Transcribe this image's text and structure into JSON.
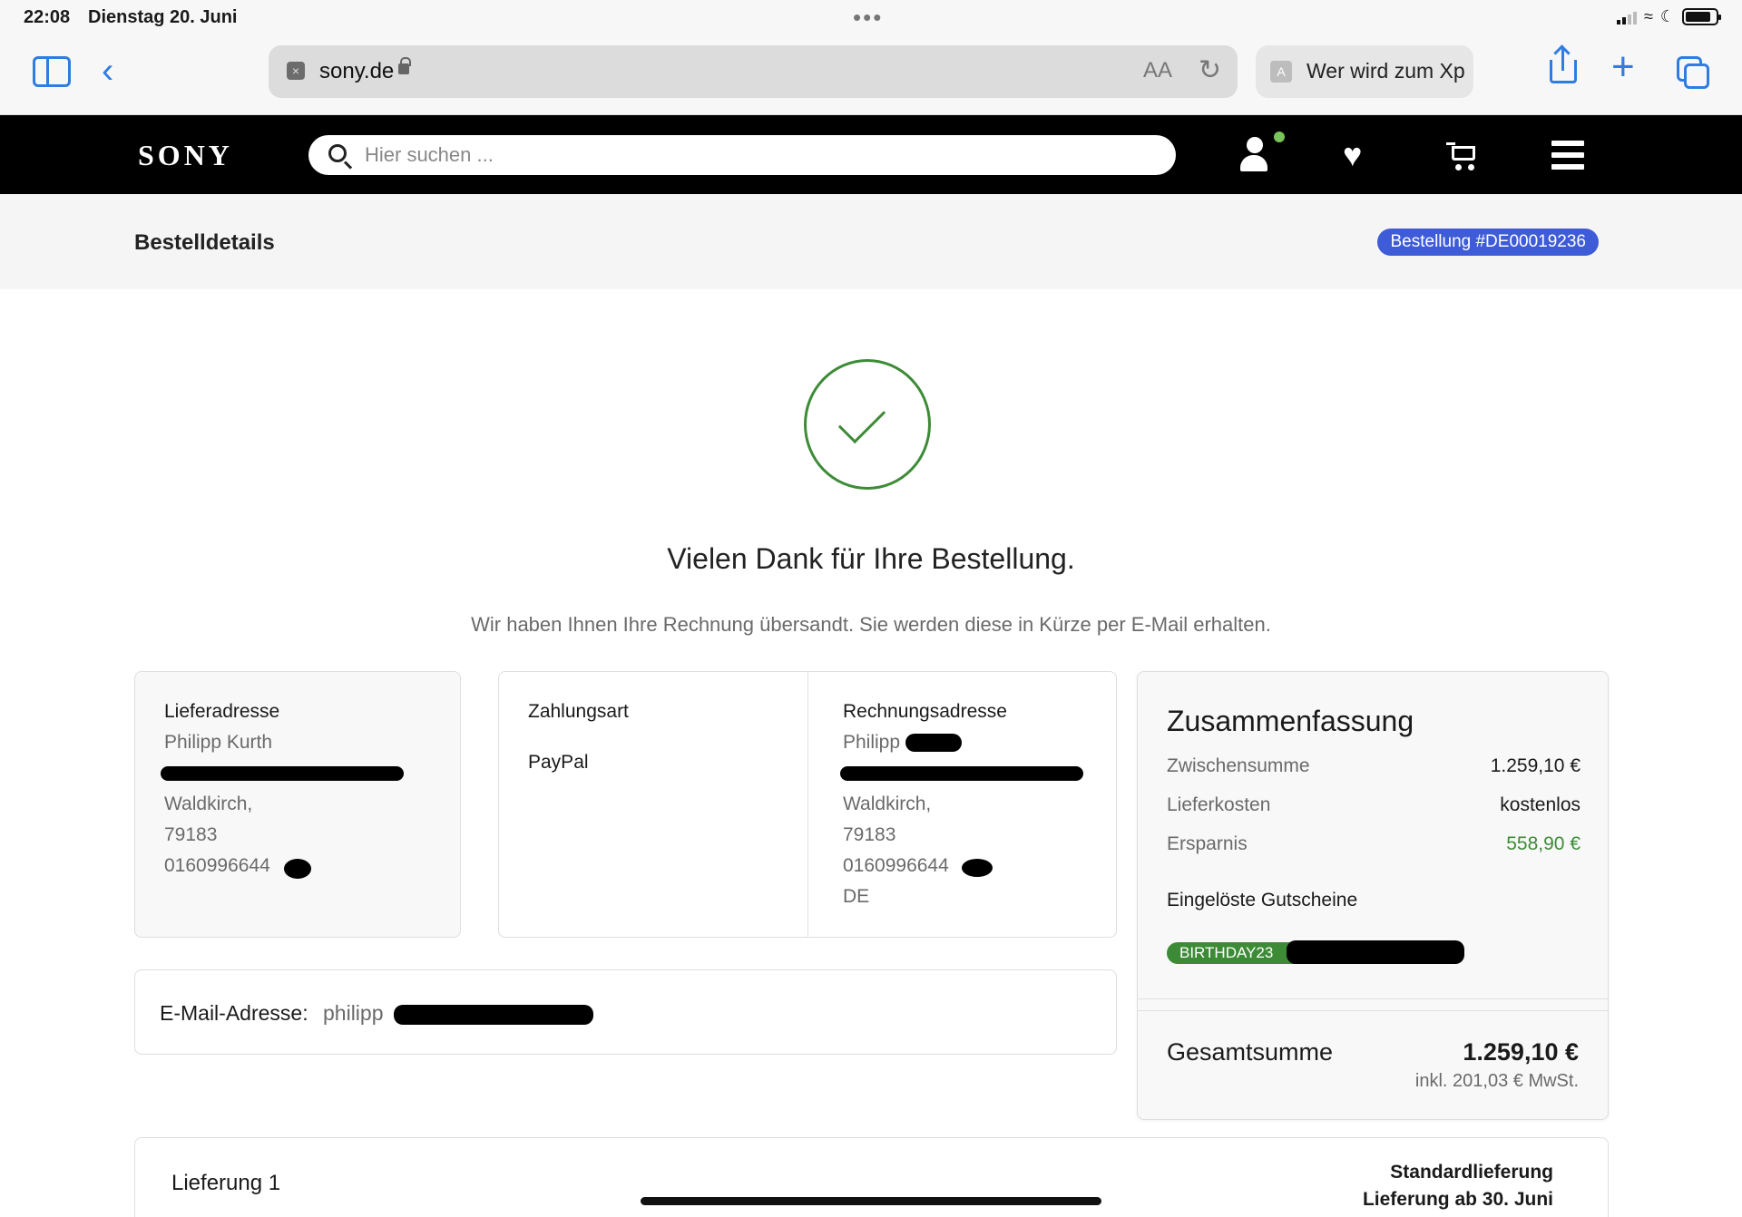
{
  "status_bar": {
    "time": "22:08",
    "date": "Dienstag 20. Juni",
    "dots": "•••"
  },
  "browser": {
    "url": "sony.de",
    "text_size": "AA",
    "tab_favicon": "A",
    "tab_title": "Wer wird zum Xp",
    "icons": [
      "sidebar-icon",
      "back-icon",
      "reload-icon",
      "share-icon",
      "plus-icon",
      "tabs-icon"
    ],
    "accent_color": "#2f7de1"
  },
  "header": {
    "logo": "SONY",
    "search_placeholder": "Hier suchen ..."
  },
  "order_bar": {
    "title": "Bestelldetails",
    "badge": "Bestellung #DE00019236",
    "badge_color": "#3e5bd8"
  },
  "success": {
    "title": "Vielen Dank für Ihre Bestellung.",
    "subtitle": "Wir haben Ihnen Ihre Rechnung übersandt. Sie werden diese in Kürze per E-Mail erhalten.",
    "color": "#3d8b37"
  },
  "shipping": {
    "label": "Lieferadresse",
    "name": "Philipp Kurth",
    "city": "Waldkirch,",
    "zip": "79183",
    "phone": "0160996644"
  },
  "payment": {
    "label": "Zahlungsart",
    "method": "PayPal"
  },
  "billing": {
    "label": "Rechnungsadresse",
    "name": "Philipp",
    "city": "Waldkirch,",
    "zip": "79183",
    "phone": "0160996644",
    "country": "DE"
  },
  "email": {
    "label": "E-Mail-Adresse:",
    "value": "philipp"
  },
  "summary": {
    "title": "Zusammenfassung",
    "rows": [
      {
        "key": "Zwischensumme",
        "value": "1.259,10 €"
      },
      {
        "key": "Lieferkosten",
        "value": "kostenlos"
      },
      {
        "key": "Ersparnis",
        "value": "558,90 €"
      }
    ],
    "coupons_title": "Eingelöste Gutscheine",
    "coupon": "BIRTHDAY23",
    "total_label": "Gesamtsumme",
    "total_value": "1.259,10 €",
    "total_tax": "inkl. 201,03 € MwSt."
  },
  "delivery": {
    "title": "Lieferung 1",
    "type": "Standardlieferung",
    "date": "Lieferung ab 30. Juni"
  }
}
